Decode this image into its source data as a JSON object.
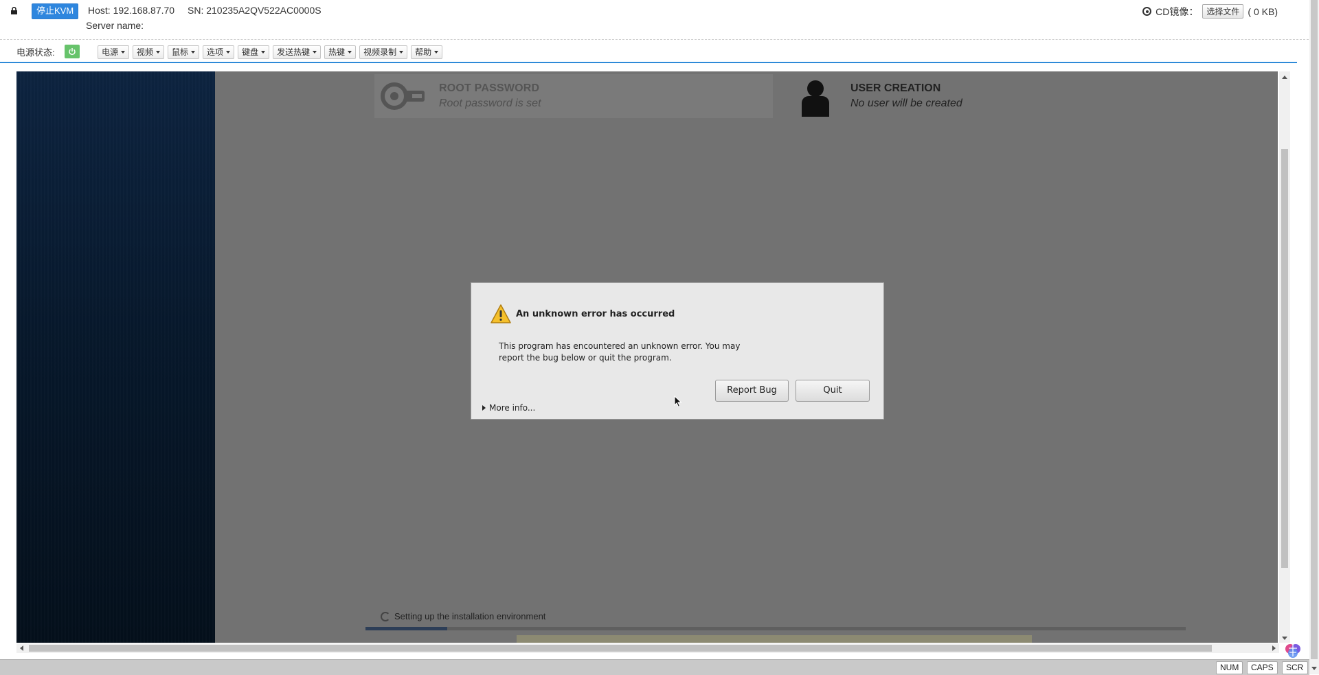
{
  "header": {
    "stop_kvm": "停止KVM",
    "host": "Host: 192.168.87.70",
    "sn": "SN: 210235A2QV522AC0000S",
    "server_name": "Server name:",
    "cd_label": "CD镜像：",
    "choose_file": "选择文件",
    "file_size": "( 0 KB)"
  },
  "toolbar": {
    "power_status_label": "电源状态:",
    "menus": [
      "电源",
      "视频",
      "鼠标",
      "选项",
      "键盘",
      "发送热键",
      "热键",
      "视频录制",
      "帮助"
    ]
  },
  "installer": {
    "root_title": "ROOT PASSWORD",
    "root_sub": "Root password is set",
    "user_title": "USER CREATION",
    "user_sub": "No user will be created",
    "progress_label": "Setting up the installation environment",
    "progress_fraction": 0.1
  },
  "dialog": {
    "title": "An unknown error has occurred",
    "message": "This program has encountered an unknown error. You may report the bug below or quit the program.",
    "report_bug": "Report Bug",
    "quit": "Quit",
    "more_info": "More info..."
  },
  "status_bar": {
    "num": "NUM",
    "caps": "CAPS",
    "scr": "SCR"
  },
  "colors": {
    "accent": "#2e86de",
    "power_on": "#67c36b",
    "kvm_background": "#727272"
  }
}
